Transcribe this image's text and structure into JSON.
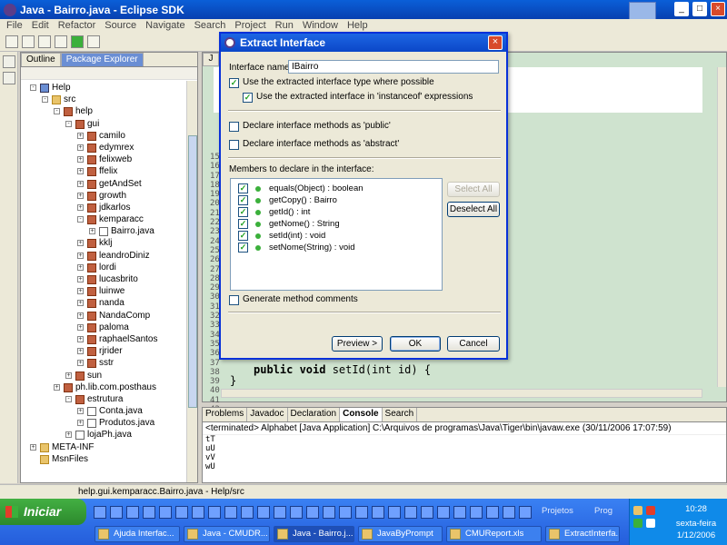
{
  "window": {
    "title": "Java - Bairro.java - Eclipse SDK"
  },
  "menu": [
    "File",
    "Edit",
    "Refactor",
    "Source",
    "Navigate",
    "Search",
    "Project",
    "Run",
    "Window",
    "Help"
  ],
  "left_tabs": [
    "Outline",
    "Package Explorer"
  ],
  "tree": [
    {
      "label": "Help",
      "depth": 0,
      "icon": "proj",
      "exp": "-"
    },
    {
      "label": "src",
      "depth": 1,
      "icon": "folder",
      "exp": "-"
    },
    {
      "label": "help",
      "depth": 2,
      "icon": "pkg",
      "exp": "-"
    },
    {
      "label": "gui",
      "depth": 3,
      "icon": "pkg",
      "exp": "-"
    },
    {
      "label": "camilo",
      "depth": 4,
      "icon": "pkg",
      "exp": "+"
    },
    {
      "label": "edymrex",
      "depth": 4,
      "icon": "pkg",
      "exp": "+"
    },
    {
      "label": "felixweb",
      "depth": 4,
      "icon": "pkg",
      "exp": "+"
    },
    {
      "label": "ffelix",
      "depth": 4,
      "icon": "pkg",
      "exp": "+"
    },
    {
      "label": "getAndSet",
      "depth": 4,
      "icon": "pkg",
      "exp": "+"
    },
    {
      "label": "growth",
      "depth": 4,
      "icon": "pkg",
      "exp": "+"
    },
    {
      "label": "jdkarlos",
      "depth": 4,
      "icon": "pkg",
      "exp": "+"
    },
    {
      "label": "kemparacc",
      "depth": 4,
      "icon": "pkg",
      "exp": "-"
    },
    {
      "label": "Bairro.java",
      "depth": 5,
      "icon": "file",
      "exp": "+"
    },
    {
      "label": "kklj",
      "depth": 4,
      "icon": "pkg",
      "exp": "+"
    },
    {
      "label": "leandroDiniz",
      "depth": 4,
      "icon": "pkg",
      "exp": "+"
    },
    {
      "label": "lordi",
      "depth": 4,
      "icon": "pkg",
      "exp": "+"
    },
    {
      "label": "lucasbrito",
      "depth": 4,
      "icon": "pkg",
      "exp": "+"
    },
    {
      "label": "luinwe",
      "depth": 4,
      "icon": "pkg",
      "exp": "+"
    },
    {
      "label": "nanda",
      "depth": 4,
      "icon": "pkg",
      "exp": "+"
    },
    {
      "label": "NandaComp",
      "depth": 4,
      "icon": "pkg",
      "exp": "+"
    },
    {
      "label": "paloma",
      "depth": 4,
      "icon": "pkg",
      "exp": "+"
    },
    {
      "label": "raphaelSantos",
      "depth": 4,
      "icon": "pkg",
      "exp": "+"
    },
    {
      "label": "rjrider",
      "depth": 4,
      "icon": "pkg",
      "exp": "+"
    },
    {
      "label": "sstr",
      "depth": 4,
      "icon": "pkg",
      "exp": "+"
    },
    {
      "label": "sun",
      "depth": 3,
      "icon": "pkg",
      "exp": "+"
    },
    {
      "label": "ph.lib.com.posthaus",
      "depth": 2,
      "icon": "pkg",
      "exp": "+"
    },
    {
      "label": "estrutura",
      "depth": 3,
      "icon": "pkg",
      "exp": "-"
    },
    {
      "label": "Conta.java",
      "depth": 4,
      "icon": "file",
      "exp": "+"
    },
    {
      "label": "Produtos.java",
      "depth": 4,
      "icon": "file",
      "exp": "+"
    },
    {
      "label": "lojaPh.java",
      "depth": 3,
      "icon": "file",
      "exp": "+"
    },
    {
      "label": "META-INF",
      "depth": 0,
      "icon": "folder",
      "exp": "+"
    },
    {
      "label": "MsnFiles",
      "depth": 0,
      "icon": "folder",
      "exp": ""
    }
  ],
  "editor": {
    "tab": "J",
    "line_numbers": [
      "15",
      "16",
      "17",
      "18",
      "19",
      "20",
      "21",
      "22",
      "23",
      "24",
      "25",
      "26",
      "27",
      "28",
      "29",
      "30",
      "31",
      "32",
      "33",
      "34",
      "35",
      "36",
      "37",
      "38",
      "39",
      "40",
      "41",
      "42"
    ],
    "code_keyword": "public void",
    "code_rest": " setId(int id) {",
    "code_close": "}"
  },
  "dialog": {
    "title": "Extract Interface",
    "interface_name_label": "Interface name:",
    "interface_name_value": "IBairro",
    "opt_use_type": "Use the extracted interface type where possible",
    "opt_instanceof": "Use the extracted interface in 'instanceof' expressions",
    "opt_public": "Declare interface methods as 'public'",
    "opt_abstract": "Declare interface methods as 'abstract'",
    "members_label": "Members to declare in the interface:",
    "members": [
      "equals(Object) : boolean",
      "getCopy() : Bairro",
      "getId() : int",
      "getNome() : String",
      "setId(int) : void",
      "setNome(String) : void"
    ],
    "select_all": "Select All",
    "deselect_all": "Deselect All",
    "generate_comments": "Generate method comments",
    "preview": "Preview >",
    "ok": "OK",
    "cancel": "Cancel"
  },
  "bottom_tabs": [
    "Problems",
    "Javadoc",
    "Declaration",
    "Console",
    "Search"
  ],
  "console": {
    "header": "<terminated> Alphabet [Java Application] C:\\Arquivos de programas\\Java\\Tiger\\bin\\javaw.exe (30/11/2006 17:07:59)",
    "lines": [
      "tT",
      "uU",
      "vV",
      "wU"
    ]
  },
  "status_text": "help.gui.kemparacc.Bairro.java - Help/src",
  "taskbar": {
    "start": "Iniciar",
    "tasks": [
      "Ajuda Interfac...",
      "Java - CMUDR...",
      "Java - Bairro.j...",
      "JavaByPrompt",
      "CMUReport.xls",
      "ExtractInterfa..."
    ],
    "groups": [
      "Projetos",
      "Prog"
    ],
    "time": "10:28",
    "day": "sexta-feira",
    "date": "1/12/2006"
  }
}
